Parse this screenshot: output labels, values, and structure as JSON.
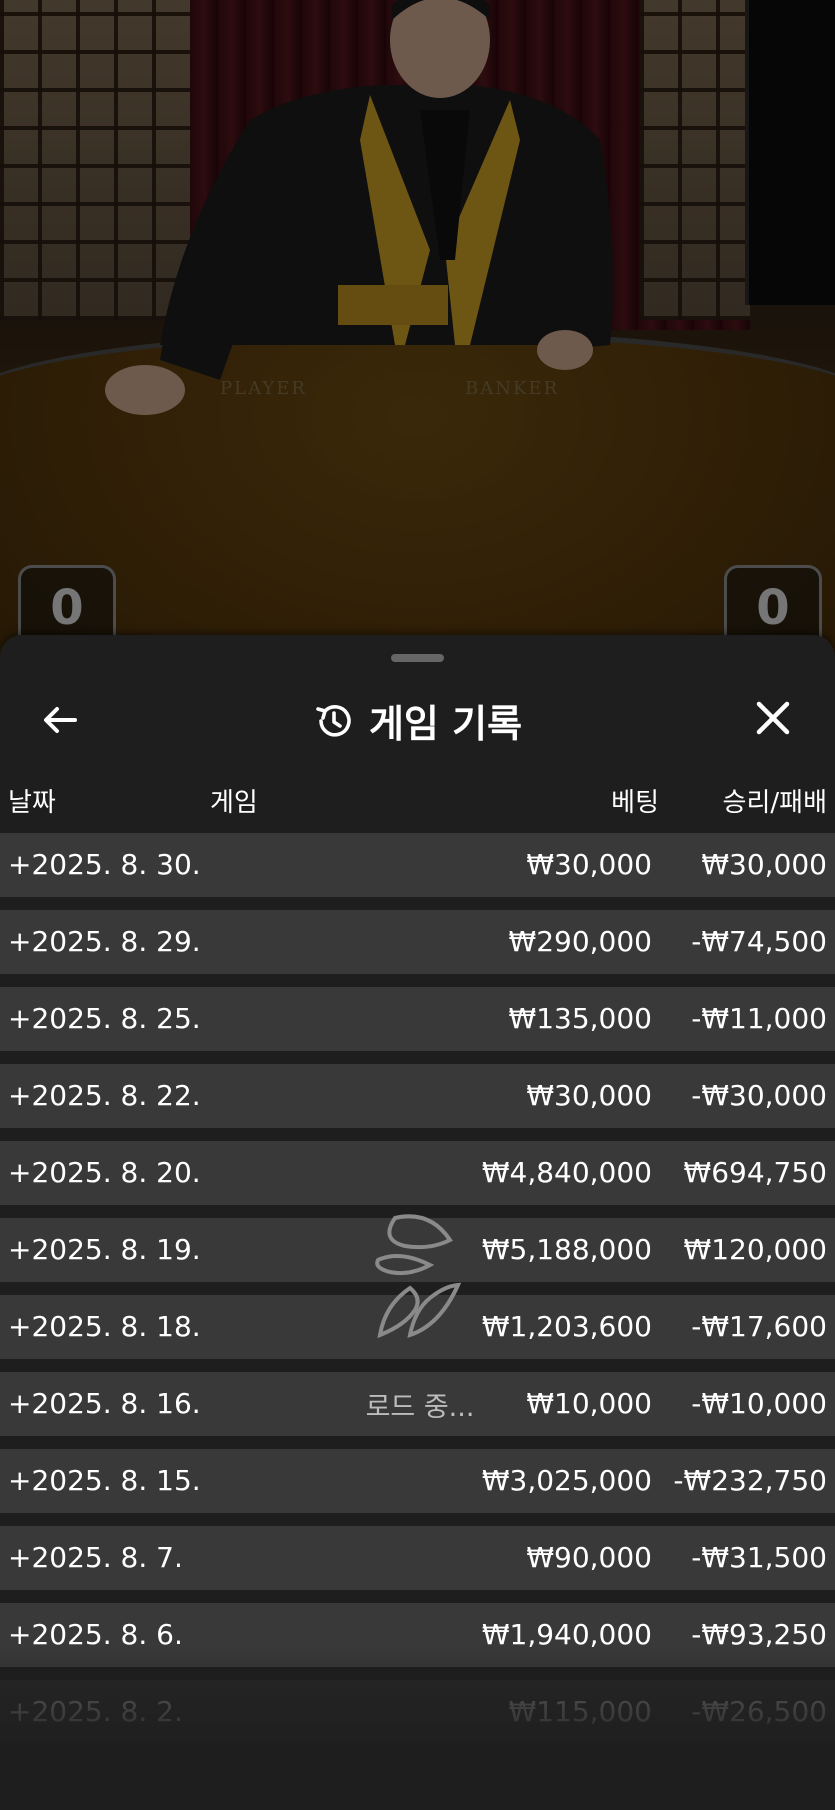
{
  "video": {
    "table_labels": [
      "PLAYER",
      "BANKER"
    ],
    "player_score": "0",
    "banker_score": "0"
  },
  "sheet": {
    "title": "게임 기록",
    "back_icon": "arrow-left-icon",
    "history_icon": "history-icon",
    "close_icon": "close-icon",
    "columns": {
      "date": "날짜",
      "game": "게임",
      "bet": "베팅",
      "winloss": "승리/패배"
    },
    "rows": [
      {
        "date": "+2025. 8. 30.",
        "bet": "₩30,000",
        "winloss": "₩30,000"
      },
      {
        "date": "+2025. 8. 29.",
        "bet": "₩290,000",
        "winloss": "-₩74,500"
      },
      {
        "date": "+2025. 8. 25.",
        "bet": "₩135,000",
        "winloss": "-₩11,000"
      },
      {
        "date": "+2025. 8. 22.",
        "bet": "₩30,000",
        "winloss": "-₩30,000"
      },
      {
        "date": "+2025. 8. 20.",
        "bet": "₩4,840,000",
        "winloss": "₩694,750"
      },
      {
        "date": "+2025. 8. 19.",
        "bet": "₩5,188,000",
        "winloss": "₩120,000"
      },
      {
        "date": "+2025. 8. 18.",
        "bet": "₩1,203,600",
        "winloss": "-₩17,600"
      },
      {
        "date": "+2025. 8. 16.",
        "bet": "₩10,000",
        "winloss": "-₩10,000"
      },
      {
        "date": "+2025. 8. 15.",
        "bet": "₩3,025,000",
        "winloss": "-₩232,750"
      },
      {
        "date": "+2025. 8. 7.",
        "bet": "₩90,000",
        "winloss": "-₩31,500"
      },
      {
        "date": "+2025. 8. 6.",
        "bet": "₩1,940,000",
        "winloss": "-₩93,250"
      },
      {
        "date": "+2025. 8. 2.",
        "bet": "₩115,000",
        "winloss": "-₩26,500"
      }
    ],
    "loading_text": "로드 중...",
    "loader_icon": "loading-spinner-icon"
  },
  "colors": {
    "sheet_bg": "#1e1e1e",
    "row_bg": "#393939",
    "text": "#ffffff"
  }
}
